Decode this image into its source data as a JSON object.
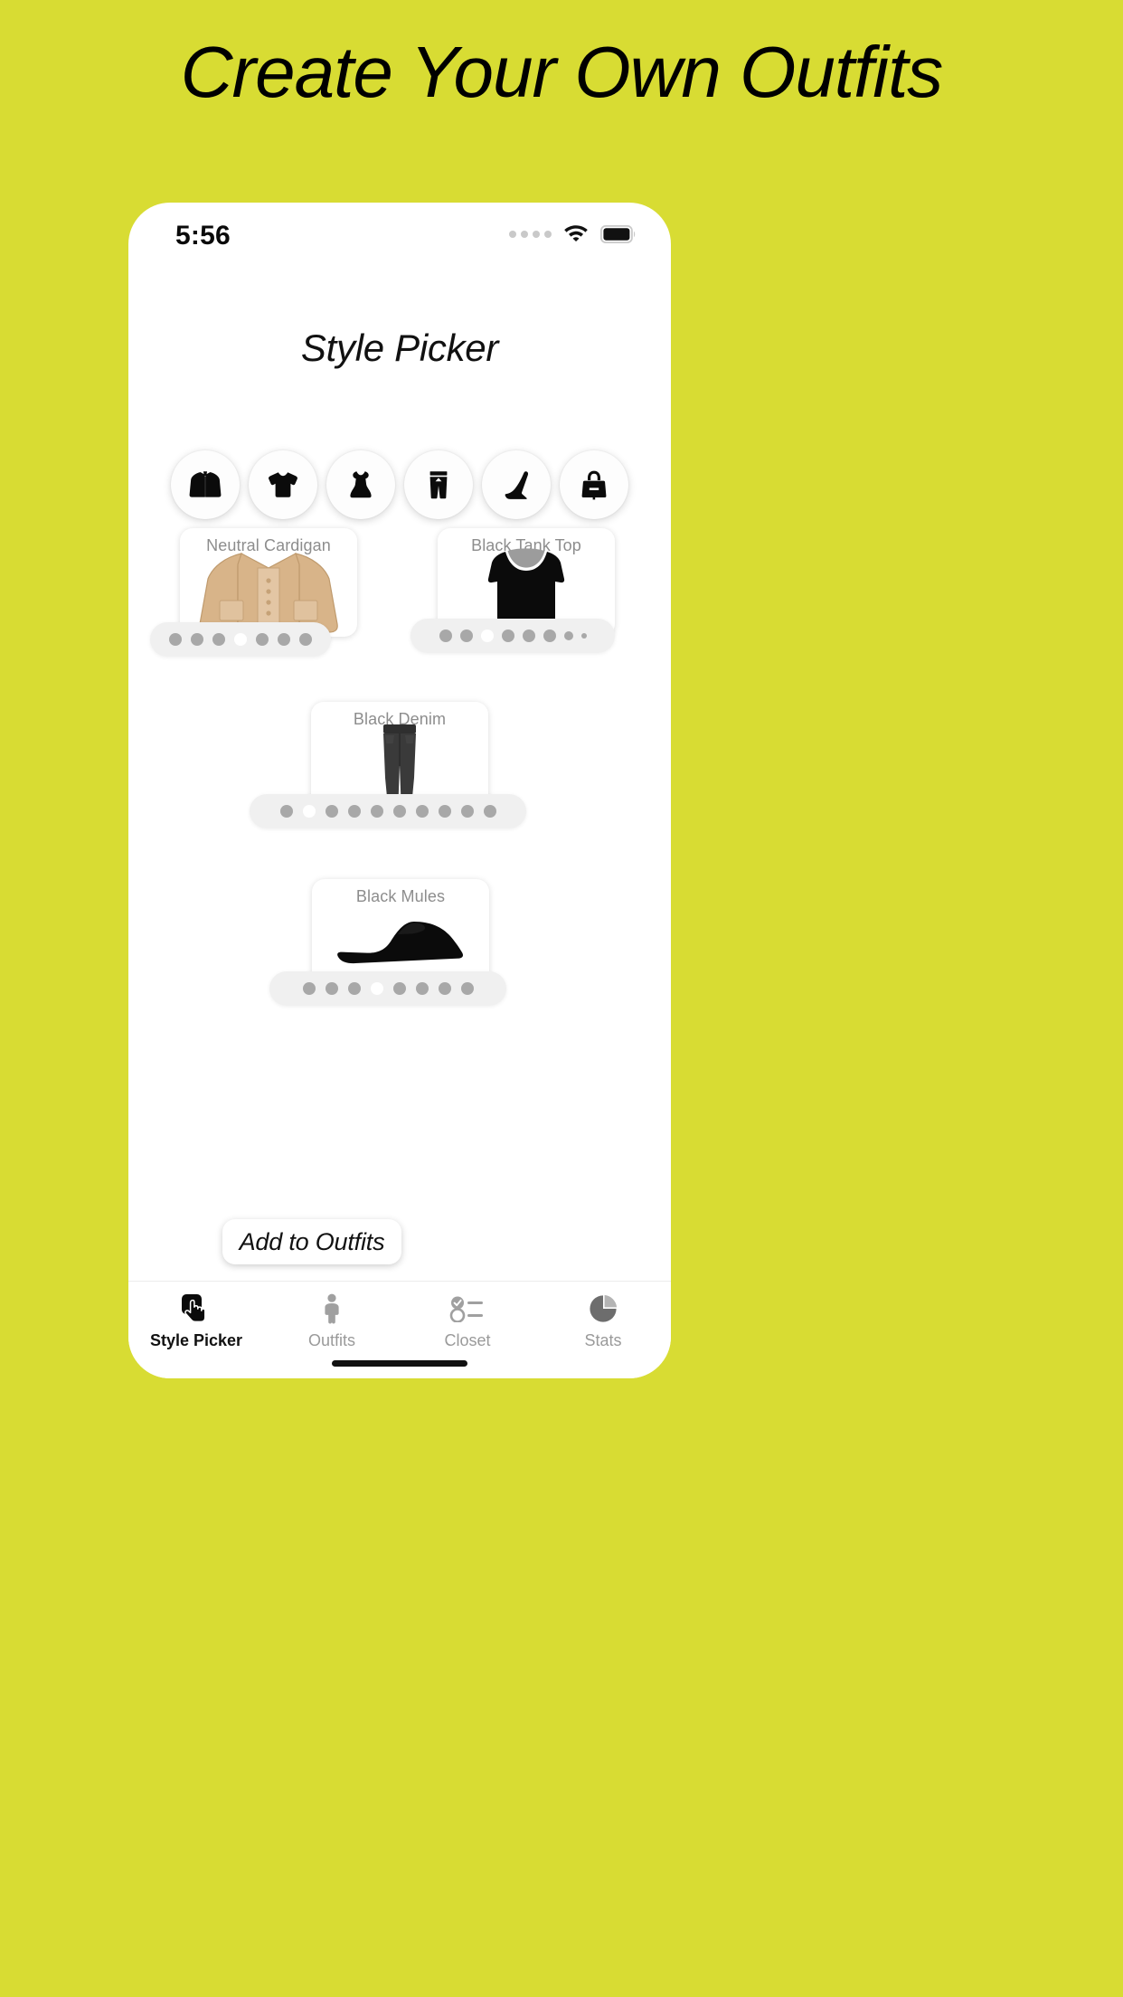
{
  "promo": {
    "headline": "Create Your Own Outfits",
    "background_color": "#d8dc33"
  },
  "status_bar": {
    "time": "5:56",
    "signal_icon": "signal-dots-icon",
    "wifi_icon": "wifi-icon",
    "battery_icon": "battery-full-icon"
  },
  "screen": {
    "title": "Style Picker"
  },
  "categories": [
    {
      "id": "outerwear",
      "label": "Outerwear",
      "icon": "jacket-icon"
    },
    {
      "id": "tops",
      "label": "Tops",
      "icon": "tshirt-icon"
    },
    {
      "id": "dresses",
      "label": "Dresses",
      "icon": "dress-icon"
    },
    {
      "id": "bottoms",
      "label": "Bottoms",
      "icon": "pants-icon"
    },
    {
      "id": "shoes",
      "label": "Shoes",
      "icon": "heel-shoe-icon"
    },
    {
      "id": "bags",
      "label": "Bags",
      "icon": "handbag-icon"
    }
  ],
  "items": [
    {
      "id": "outerwear-slot",
      "title": "Neutral Cardigan",
      "art": "cardigan-art",
      "pagination": {
        "count": 7,
        "active_index": 3,
        "small_tail": 0
      }
    },
    {
      "id": "top-slot",
      "title": "Black Tank Top",
      "art": "tank-top-art",
      "pagination": {
        "count": 8,
        "active_index": 2,
        "small_tail": 2
      }
    },
    {
      "id": "bottom-slot",
      "title": "Black Denim",
      "art": "denim-art",
      "pagination": {
        "count": 10,
        "active_index": 1,
        "small_tail": 0
      }
    },
    {
      "id": "shoe-slot",
      "title": "Black Mules",
      "art": "mule-art",
      "pagination": {
        "count": 8,
        "active_index": 3,
        "small_tail": 0
      }
    }
  ],
  "primary_action": {
    "label": "Add to Outfits"
  },
  "tabs": [
    {
      "id": "style-picker",
      "label": "Style Picker",
      "icon": "tap-hand-icon",
      "active": true
    },
    {
      "id": "outfits",
      "label": "Outfits",
      "icon": "person-icon",
      "active": false
    },
    {
      "id": "closet",
      "label": "Closet",
      "icon": "checklist-icon",
      "active": false
    },
    {
      "id": "stats",
      "label": "Stats",
      "icon": "pie-chart-icon",
      "active": false
    }
  ],
  "colors": {
    "brand_background": "#d8dc33",
    "card_background": "#ffffff",
    "muted_text": "#8d8d8d",
    "dot_inactive": "#a8a8a8",
    "dot_active": "#ffffff",
    "cardigan_tan": "#d3b083",
    "denim_black": "#3a3a3a"
  }
}
